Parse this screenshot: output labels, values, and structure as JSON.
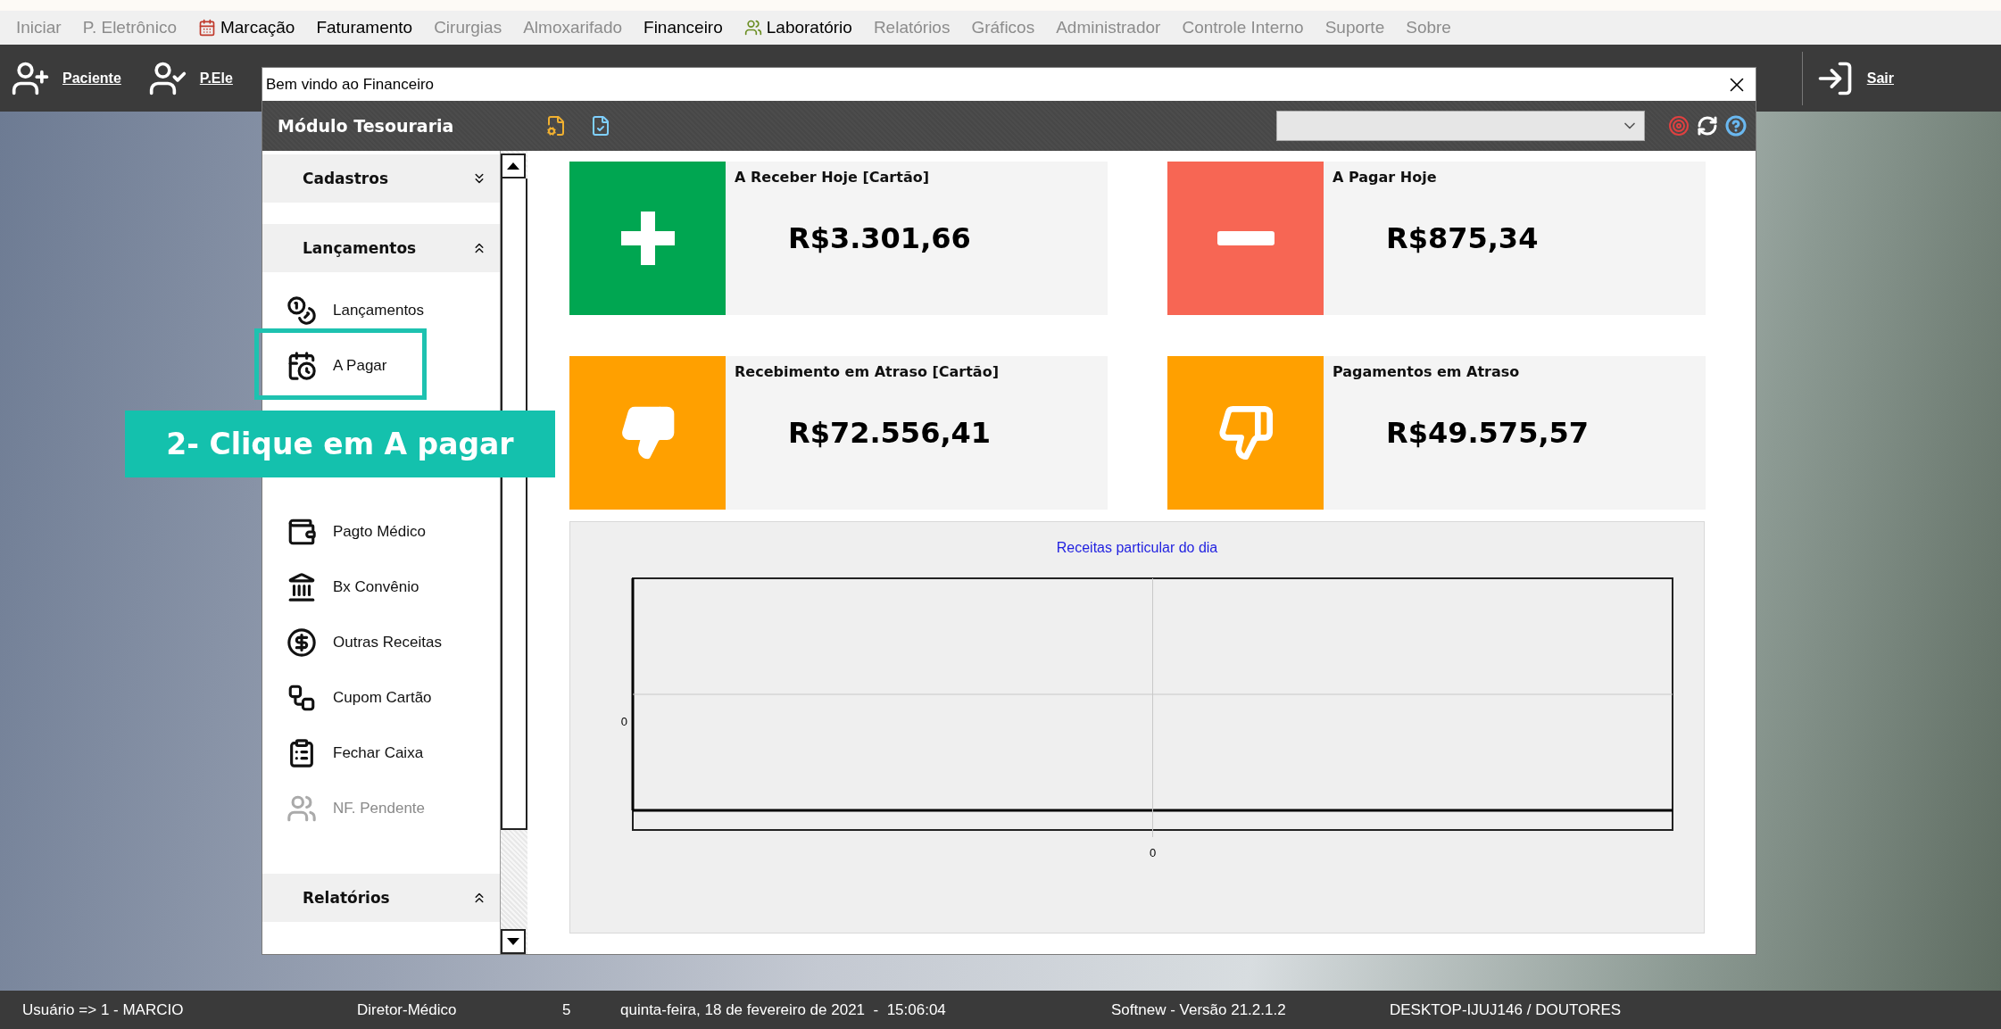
{
  "menu_bar": [
    {
      "label": "Iniciar",
      "disabled": true,
      "has_icon": false
    },
    {
      "label": "P. Eletrônico",
      "disabled": true,
      "has_icon": false
    },
    {
      "label": "Marcação",
      "disabled": false,
      "has_icon": true
    },
    {
      "label": "Faturamento",
      "disabled": false,
      "has_icon": false
    },
    {
      "label": "Cirurgias",
      "disabled": true,
      "has_icon": false
    },
    {
      "label": "Almoxarifado",
      "disabled": true,
      "has_icon": false
    },
    {
      "label": "Financeiro",
      "disabled": false,
      "has_icon": false
    },
    {
      "label": "Laboratório",
      "disabled": false,
      "has_icon": true
    },
    {
      "label": "Relatórios",
      "disabled": true,
      "has_icon": false
    },
    {
      "label": "Gráficos",
      "disabled": true,
      "has_icon": false
    },
    {
      "label": "Administrador",
      "disabled": true,
      "has_icon": false
    },
    {
      "label": "Controle Interno",
      "disabled": true,
      "has_icon": false
    },
    {
      "label": "Suporte",
      "disabled": true,
      "has_icon": false
    },
    {
      "label": "Sobre",
      "disabled": true,
      "has_icon": false
    }
  ],
  "toolbar": [
    {
      "label": "Paciente",
      "kind": "patient"
    },
    {
      "label": "P.Ele",
      "kind": "record"
    },
    {
      "label": "Sair",
      "kind": "exit"
    }
  ],
  "window": {
    "title": "Bem vindo ao Financeiro"
  },
  "module_header": {
    "title": "Módulo Tesouraria"
  },
  "sidebar": {
    "groups": [
      {
        "label": "Cadastros",
        "expanded": false
      },
      {
        "label": "Lançamentos",
        "expanded": true,
        "items": [
          {
            "label": "Lançamentos",
            "disabled": false
          },
          {
            "label": "A Pagar",
            "disabled": false
          },
          {
            "label": "Pagto Médico",
            "disabled": false
          },
          {
            "label": "Bx Convênio",
            "disabled": false
          },
          {
            "label": "Outras Receitas",
            "disabled": false
          },
          {
            "label": "Cupom Cartão",
            "disabled": false
          },
          {
            "label": "Fechar Caixa",
            "disabled": false
          },
          {
            "label": "NF. Pendente",
            "disabled": true
          }
        ]
      },
      {
        "label": "Relatórios",
        "expanded": true
      }
    ]
  },
  "cards": [
    {
      "title": "A Receber Hoje [Cartão]",
      "value": "R$3.301,66",
      "kind": "plus",
      "color": "#00a651"
    },
    {
      "title": "A Pagar Hoje",
      "value": "R$875,34",
      "kind": "minus",
      "color": "#f76654"
    },
    {
      "title": "Recebimento em Atraso [Cartão]",
      "value": "R$72.556,41",
      "kind": "thumbs_down_filled",
      "color": "#ffa000"
    },
    {
      "title": "Pagamentos em Atraso",
      "value": "R$49.575,57",
      "kind": "thumbs_down_outline",
      "color": "#ffa000"
    }
  ],
  "chart": {
    "title": "Receitas particular do dia",
    "x_axis_label": "0",
    "y_axis_label": "0"
  },
  "tutorial": {
    "callout": "2- Clique em A pagar"
  },
  "status_bar": [
    "Usuário => 1 - MARCIO",
    "Diretor-Médico",
    "5",
    "quinta-feira, 18 de fevereiro de 2021  -  15:06:04",
    "Softnew - Versão 21.2.1.2",
    "DESKTOP-IJUJ146 / DOUTORES"
  ]
}
